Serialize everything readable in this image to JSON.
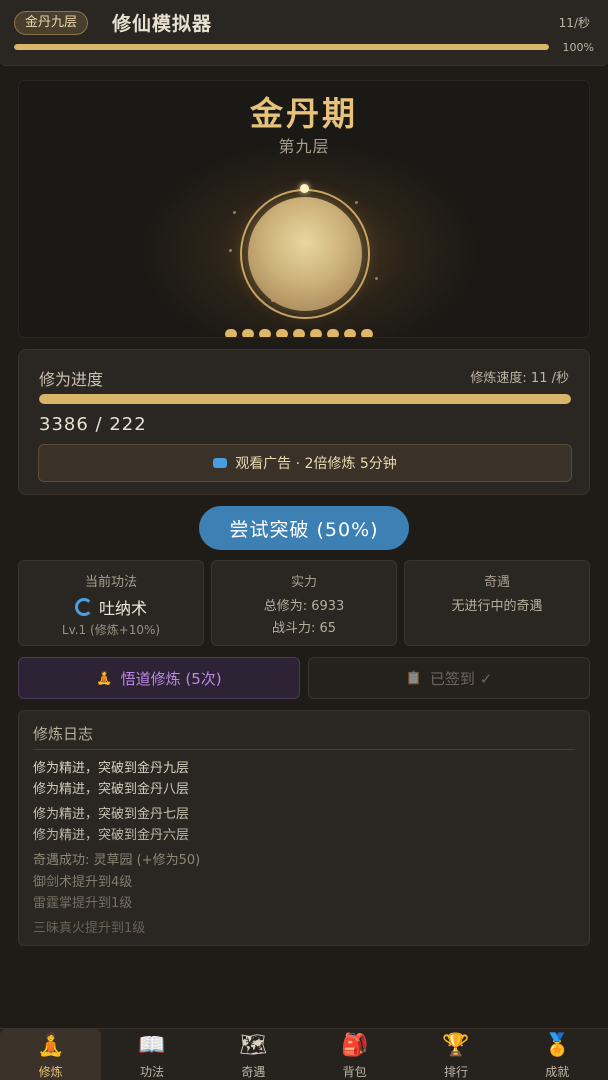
{
  "header": {
    "realm_badge": "金丹九层",
    "app_title": "修仙模拟器",
    "rate": "11/秒",
    "progress_percent_label": "100%",
    "progress_fraction": 1.0
  },
  "hero": {
    "stage_title": "金丹期",
    "stage_sub": "第九层",
    "layers_total": 9
  },
  "progress": {
    "label": "修为进度",
    "speed": "修炼速度: 11 /秒",
    "value": "3386 / 222",
    "fill_fraction": 1.0,
    "ad_button": "观看广告 · 2倍修炼 5分钟"
  },
  "breakthrough": {
    "label": "尝试突破 (50%)"
  },
  "cards": {
    "technique": {
      "title": "当前功法",
      "name": "吐纳术",
      "level": "Lv.1 (修炼+10%)"
    },
    "power": {
      "title": "实力",
      "total": "总修为: 6933",
      "combat": "战斗力: 65"
    },
    "encounter": {
      "title": "奇遇",
      "status": "无进行中的奇遇"
    }
  },
  "actions": {
    "meditate": "悟道修炼 (5次)",
    "checkin": "已签到 ✓"
  },
  "log": {
    "title": "修炼日志",
    "entries": [
      {
        "text": "修为精进，突破到金丹九层",
        "color": "#d8d0c0"
      },
      {
        "text": "修为精进，突破到金丹八层",
        "color": "#d0c8b8"
      },
      {
        "text": "修为精进，突破到金丹七层",
        "color": "#c8c0b0"
      },
      {
        "text": "修为精进，突破到金丹六层",
        "color": "#c0b8a8"
      },
      {
        "text": "奇遇成功: 灵草园 (+修为50)",
        "color": "#8e8676"
      },
      {
        "text": "御剑术提升到4级",
        "color": "#827a6c"
      },
      {
        "text": "雷霆掌提升到1级",
        "color": "#766e62"
      },
      {
        "text": "三昧真火提升到1级",
        "color": "#6a6258"
      }
    ]
  },
  "nav": {
    "items": [
      {
        "label": "修炼",
        "icon": "meditation-icon",
        "glyph": "🧘"
      },
      {
        "label": "功法",
        "icon": "book-icon",
        "glyph": "📖"
      },
      {
        "label": "奇遇",
        "icon": "map-icon",
        "glyph": "🗺"
      },
      {
        "label": "背包",
        "icon": "backpack-icon",
        "glyph": "🎒"
      },
      {
        "label": "排行",
        "icon": "trophy-icon",
        "glyph": "🏆"
      },
      {
        "label": "成就",
        "icon": "medal-icon",
        "glyph": "🏅"
      }
    ],
    "active_index": 0
  },
  "colors": {
    "gold": "#d9b56a",
    "blue_button": "#3c80b4",
    "purple_text": "#b88ae0"
  }
}
